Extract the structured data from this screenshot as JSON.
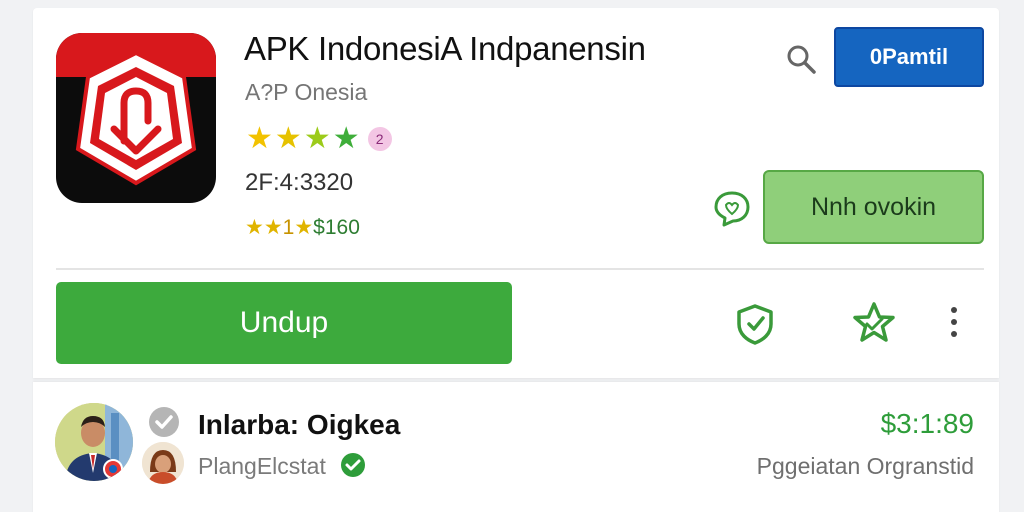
{
  "app": {
    "title": "APK IndonesiA Indpanensin",
    "developer": "A?P Onesia",
    "rating_badge": "2",
    "code_text": "2F:4:3320",
    "small_rating": {
      "stars": "★★",
      "middle": "1",
      "star2": "★",
      "tail": "$160"
    },
    "stars": [
      {
        "char": "★",
        "color": "#f2c200"
      },
      {
        "char": "★",
        "color": "#e6c200"
      },
      {
        "char": "★",
        "color": "#9ccb1a"
      },
      {
        "char": "★",
        "color": "#3fae3a"
      }
    ]
  },
  "header": {
    "blue_button_label": "0Pamtil"
  },
  "secondary": {
    "green_button_label": "Nnh ovokin"
  },
  "actions": {
    "install_label": "Undup"
  },
  "review": {
    "name": "Inlarba: Oigkea",
    "subtitle": "PlangElcstat",
    "price": "$3:1:89",
    "price_sub": "Pggeiatan Orgranstid"
  },
  "colors": {
    "primary_blue": "#1565c0",
    "install_green": "#3daa3d",
    "outline_green": "#8fcf7a",
    "icon_green": "#3a9a3a",
    "brand_red": "#d8181c"
  },
  "icons": {
    "search": "search-icon",
    "chat": "chat-heart-icon",
    "shield": "shield-icon",
    "wishlist": "star-outline-icon",
    "more": "more-vert-icon",
    "verified_gray": "verified-gray-icon",
    "verified_green": "check-circle-icon"
  }
}
